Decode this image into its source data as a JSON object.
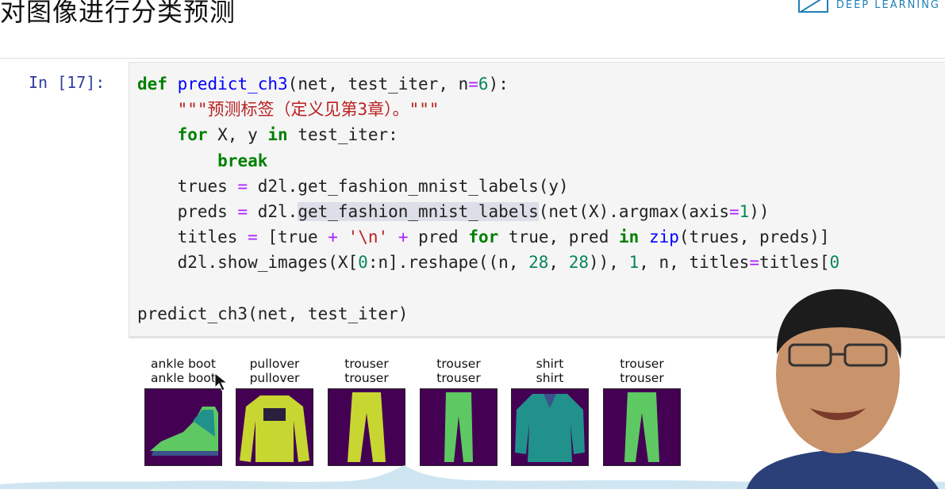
{
  "header": {
    "title": "对图像进行分类预测",
    "brand": "DEEP LEARNING"
  },
  "cell": {
    "prompt": "In [17]:",
    "code": {
      "l1_kw": "def",
      "l1_fn": "predict_ch3",
      "l1_a": "(net, test_iter, n",
      "l1_op": "=",
      "l1_num": "6",
      "l1_b": "):",
      "l2_indent": "    ",
      "l2_str": "\"\"\"预测标签（定义见第3章）。\"\"\"",
      "l3_kw": "for",
      "l3_a": " X, y ",
      "l3_kw2": "in",
      "l3_b": " test_iter:",
      "l4_kw": "break",
      "l5_a": "trues ",
      "l5_op": "=",
      "l5_b": " d2l.get_fashion_mnist_labels(y)",
      "l6_a": "preds ",
      "l6_op": "=",
      "l6_b": " d2l.",
      "l6_hl": "get_fashion_mnist_labels",
      "l6_c": "(net(X).argmax(axis",
      "l6_op2": "=",
      "l6_num": "1",
      "l6_d": "))",
      "l7_a": "titles ",
      "l7_op": "=",
      "l7_b": " [true ",
      "l7_op2": "+",
      "l7_str": "'\\n'",
      "l7_op3": "+",
      "l7_c": " pred ",
      "l7_kw": "for",
      "l7_d": " true, pred ",
      "l7_kw2": "in",
      "l7_fn": "zip",
      "l7_e": "(trues, preds)]",
      "l8_a": "d2l.show_images(X[",
      "l8_num": "0",
      "l8_b": ":n].reshape((n, ",
      "l8_num2": "28",
      "l8_c": ", ",
      "l8_num3": "28",
      "l8_d": ")), ",
      "l8_num4": "1",
      "l8_e": ", n, titles",
      "l8_op": "=",
      "l8_f": "titles[",
      "l8_num5": "0",
      "l10": "predict_ch3(net, test_iter)"
    }
  },
  "output": {
    "images": [
      {
        "true_label": "ankle boot",
        "pred_label": "ankle boot",
        "icon": "ankle-boot-image"
      },
      {
        "true_label": "pullover",
        "pred_label": "pullover",
        "icon": "pullover-image"
      },
      {
        "true_label": "trouser",
        "pred_label": "trouser",
        "icon": "trouser-image"
      },
      {
        "true_label": "trouser",
        "pred_label": "trouser",
        "icon": "trouser-image"
      },
      {
        "true_label": "shirt",
        "pred_label": "shirt",
        "icon": "shirt-image"
      },
      {
        "true_label": "trouser",
        "pred_label": "trouser",
        "icon": "trouser-image"
      }
    ]
  },
  "colors": {
    "image_background": "#440154",
    "image_foreground": "#c8d632",
    "keyword": "#008000",
    "function": "#0000ff",
    "string": "#ba2121",
    "number": "#098658",
    "operator": "#aa22ff",
    "prompt": "#303f9f"
  }
}
